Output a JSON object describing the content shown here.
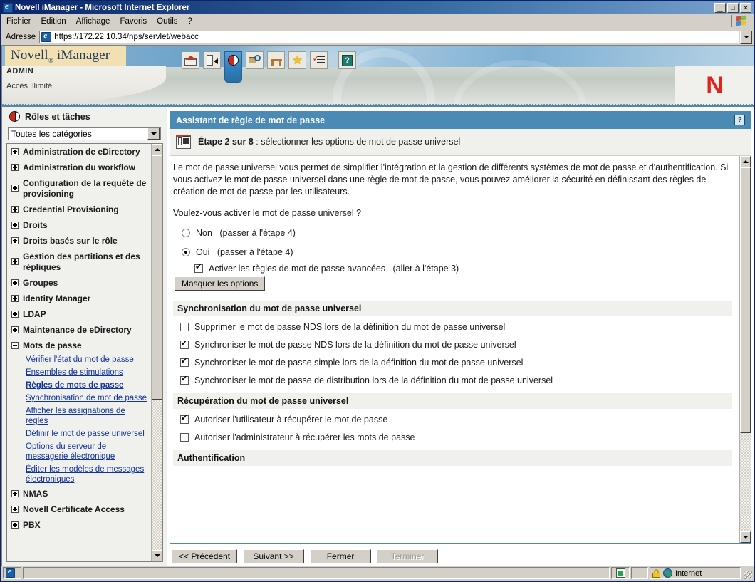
{
  "window": {
    "title": "Novell iManager - Microsoft Internet Explorer",
    "minimize": "_",
    "maximize": "□",
    "close": "✕"
  },
  "menu": {
    "items": [
      "Fichier",
      "Edition",
      "Affichage",
      "Favoris",
      "Outils",
      "?"
    ]
  },
  "address": {
    "label": "Adresse",
    "url": "https://172.22.10.34/nps/servlet/webacc"
  },
  "banner": {
    "product": "Novell",
    "product_mark": "®",
    "product_suffix": "iManager",
    "user": "ADMIN",
    "access": "Accès Illimité",
    "logo_letter": "N",
    "toolbar": [
      {
        "name": "home-icon",
        "title": "Accueil"
      },
      {
        "name": "exit-icon",
        "title": "Quitter"
      },
      {
        "name": "roles-and-tasks-icon",
        "title": "Rôles et tâches"
      },
      {
        "name": "search-icon",
        "title": "Rechercher"
      },
      {
        "name": "configure-icon",
        "title": "Configurer"
      },
      {
        "name": "favorites-star-icon",
        "title": "Favoris"
      },
      {
        "name": "checklist-icon",
        "title": "Tâches"
      },
      {
        "name": "help-book-icon",
        "title": "Aide"
      }
    ]
  },
  "sidebar": {
    "header": "Rôles et tâches",
    "category_select": "Toutes les catégories",
    "tree": [
      {
        "label": "Administration de eDirectory",
        "expanded": false
      },
      {
        "label": "Administration du workflow",
        "expanded": false
      },
      {
        "label": "Configuration de la requête de provisioning",
        "expanded": false
      },
      {
        "label": "Credential Provisioning",
        "expanded": false
      },
      {
        "label": "Droits",
        "expanded": false
      },
      {
        "label": "Droits basés sur le rôle",
        "expanded": false
      },
      {
        "label": "Gestion des partitions et des répliques",
        "expanded": false
      },
      {
        "label": "Groupes",
        "expanded": false
      },
      {
        "label": "Identity Manager",
        "expanded": false
      },
      {
        "label": "LDAP",
        "expanded": false
      },
      {
        "label": "Maintenance de eDirectory",
        "expanded": false
      },
      {
        "label": "Mots de passe",
        "expanded": true
      },
      {
        "label": "NMAS",
        "expanded": false
      },
      {
        "label": "Novell Certificate Access",
        "expanded": false
      },
      {
        "label": "PBX",
        "expanded": false
      }
    ],
    "password_links": [
      {
        "label": "Vérifier l'état du mot de passe",
        "current": false
      },
      {
        "label": "Ensembles de stimulations",
        "current": false
      },
      {
        "label": "Règles de mots de passe",
        "current": true
      },
      {
        "label": "Synchronisation de mot de passe",
        "current": false
      },
      {
        "label": "Afficher les assignations de règles",
        "current": false
      },
      {
        "label": "Définir le mot de passe universel",
        "current": false
      },
      {
        "label": "Options du serveur de messagerie électronique",
        "current": false
      },
      {
        "label": "Éditer les modèles de messages électroniques",
        "current": false
      }
    ]
  },
  "panel": {
    "title": "Assistant de règle de mot de passe",
    "help_glyph": "?",
    "step_prefix": "Étape 2 sur 8",
    "step_separator": " : ",
    "step_title": "sélectionner les options de mot de passe universel",
    "intro": "Le mot de passe universel vous permet de simplifier l'intégration et la gestion de différents systèmes de mot de passe et d'authentification. Si vous activez le mot de passe universel dans une règle de mot de passe, vous pouvez améliorer la sécurité en définissant des règles de création de mot de passe par les utilisateurs.",
    "question": "Voulez-vous activer le mot de passe universel ?",
    "radios": [
      {
        "label": "Non",
        "hint": "(passer à l'étape 4)",
        "checked": false
      },
      {
        "label": "Oui",
        "hint": "(passer à l'étape 4)",
        "checked": true
      }
    ],
    "advanced_checkbox": {
      "label": "Activer les règles de mot de passe avancées",
      "hint": "(aller à l'étape 3)",
      "checked": true
    },
    "hide_options_button": "Masquer les options",
    "sections": [
      {
        "heading": "Synchronisation du mot de passe universel",
        "options": [
          {
            "label": "Supprimer le mot de passe NDS lors de la définition du mot de passe universel",
            "checked": false
          },
          {
            "label": "Synchroniser le mot de passe NDS lors de la définition du mot de passe universel",
            "checked": true
          },
          {
            "label": "Synchroniser le mot de passe simple lors de la définition du mot de passe universel",
            "checked": true
          },
          {
            "label": "Synchroniser le mot de passe de distribution lors de la définition du mot de passe universel",
            "checked": true
          }
        ]
      },
      {
        "heading": "Récupération du mot de passe universel",
        "options": [
          {
            "label": "Autoriser l'utilisateur à récupérer le mot de passe",
            "checked": true
          },
          {
            "label": "Autoriser l'administrateur à récupérer les mots de passe",
            "checked": false
          }
        ]
      },
      {
        "heading": "Authentification",
        "options": []
      }
    ],
    "wizard_buttons": [
      {
        "label": "<< Précédent",
        "disabled": false
      },
      {
        "label": "Suivant >>",
        "disabled": false
      },
      {
        "label": "Fermer",
        "disabled": false
      },
      {
        "label": "Terminer",
        "disabled": true
      }
    ]
  },
  "statusbar": {
    "zone": "Internet"
  }
}
